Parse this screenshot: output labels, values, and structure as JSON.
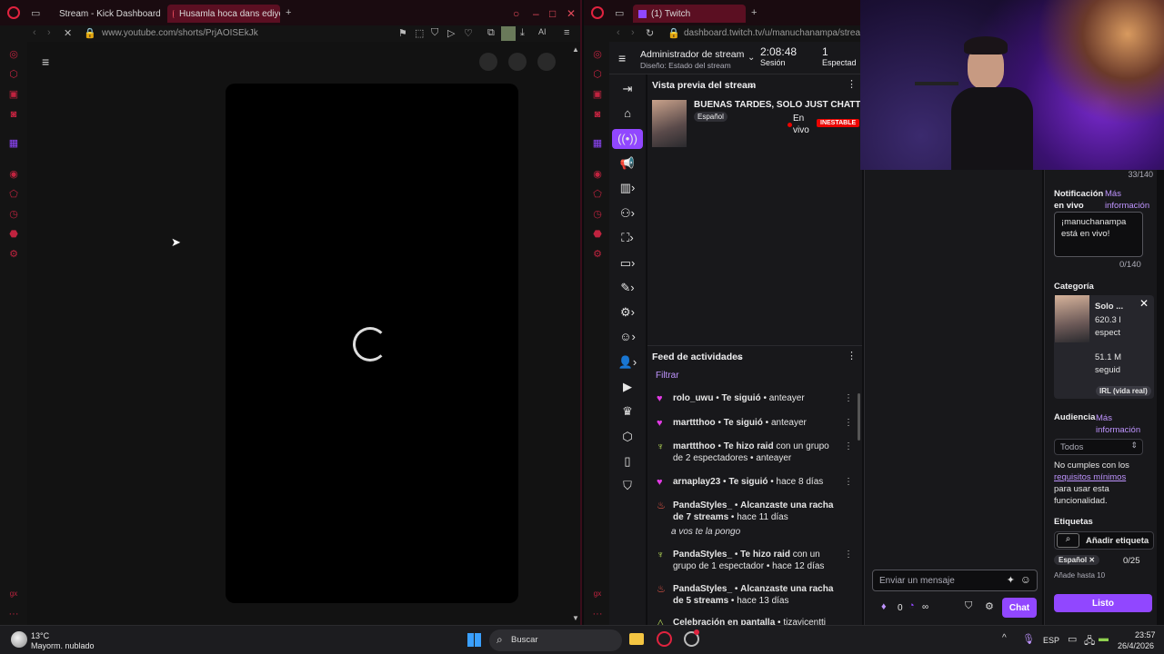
{
  "left_browser": {
    "tabs": [
      {
        "label": "Stream - Kick Dashboard"
      },
      {
        "label": "Husamla hoca dans ediyor"
      }
    ],
    "url": "www.youtube.com/shorts/PrjAOISEkJk"
  },
  "right_browser": {
    "tab_label": "(1) Twitch",
    "url": "dashboard.twitch.tv/u/manuchanampa/stream-",
    "header": {
      "title": "Administrador de stream",
      "subtitle": "Diseño: Estado del stream",
      "session_time": "2:08:48",
      "session_label": "Sesión",
      "viewers": "1",
      "viewers_label": "Espectad"
    },
    "preview": {
      "section_title": "Vista previa del stream",
      "stream_title": "BUENAS TARDES, SOLO JUST CHATTING",
      "language": "Español",
      "live_label": "En vivo",
      "unstable_label": "INESTABLE"
    },
    "activity": {
      "section_title": "Feed de actividades",
      "filter_label": "Filtrar",
      "items": [
        {
          "user": "rolo_uwu",
          "action": "Te siguió",
          "rest": "",
          "time": "anteayer",
          "icon": "heart-icon"
        },
        {
          "user": "marttthoo",
          "action": "Te siguió",
          "rest": "",
          "time": "anteayer",
          "icon": "heart-icon"
        },
        {
          "user": "marttthoo",
          "action": "Te hizo raid",
          "rest": "con un grupo de 2 espectadores",
          "time": "anteayer",
          "icon": "raid-icon"
        },
        {
          "user": "arnaplay23",
          "action": "Te siguió",
          "rest": "",
          "time": "hace 8 días",
          "icon": "heart-icon"
        },
        {
          "user": "PandaStyles_",
          "action": "Alcanzaste una racha de 7 streams",
          "rest": "",
          "time": "hace 11 días",
          "note": "a vos te la pongo",
          "icon": "streak-icon"
        },
        {
          "user": "PandaStyles_",
          "action": "Te hizo raid",
          "rest": "con un grupo de 1 espectador",
          "time": "hace 12 días",
          "icon": "raid-icon"
        },
        {
          "user": "PandaStyles_",
          "action": "Alcanzaste una racha de 5 streams",
          "rest": "",
          "time": "hace 13 días",
          "icon": "streak-icon"
        },
        {
          "user": "Celebración en pantalla",
          "action": "",
          "rest": "tizavicentti",
          "time": "",
          "icon": "celebration-icon"
        }
      ]
    },
    "chat": {
      "placeholder": "Enviar un mensaje",
      "points": "0",
      "infinity": "∞",
      "send_label": "Chat"
    },
    "info_panel": {
      "char_count_title": "33/140",
      "notification_label": "Notificación en vivo",
      "more_info": "Más información",
      "notification_text": "¡manuchanampa está en vivo!",
      "notification_count": "0/140",
      "category_label": "Categoría",
      "category_name": "Solo ...",
      "category_viewers": "620.3 l espect",
      "category_followers": "51.1 M seguid",
      "category_tag": "IRL (vida real)",
      "audience_label": "Audiencia",
      "audience_more": "Más información",
      "audience_select": "Todos",
      "audience_note_1": "No cumples con los",
      "audience_link": "requisitos mínimos",
      "audience_note_2": "para usar esta funcionalidad.",
      "tags_label": "Etiquetas",
      "add_tag_label": "Añadir etiqueta",
      "tag": "Español",
      "tag_count": "0/25",
      "tag_hint": "Añade hasta 10",
      "done_label": "Listo"
    }
  },
  "taskbar": {
    "weather_temp": "13°C",
    "weather_desc": "Mayorm. nublado",
    "search_label": "Buscar",
    "language": "ESP",
    "time": "23:57",
    "date": "26/4/2026"
  },
  "colors": {
    "opera_red": "#c0233f",
    "twitch_purple": "#9147ff",
    "twitch_text_purple": "#bf94ff"
  }
}
